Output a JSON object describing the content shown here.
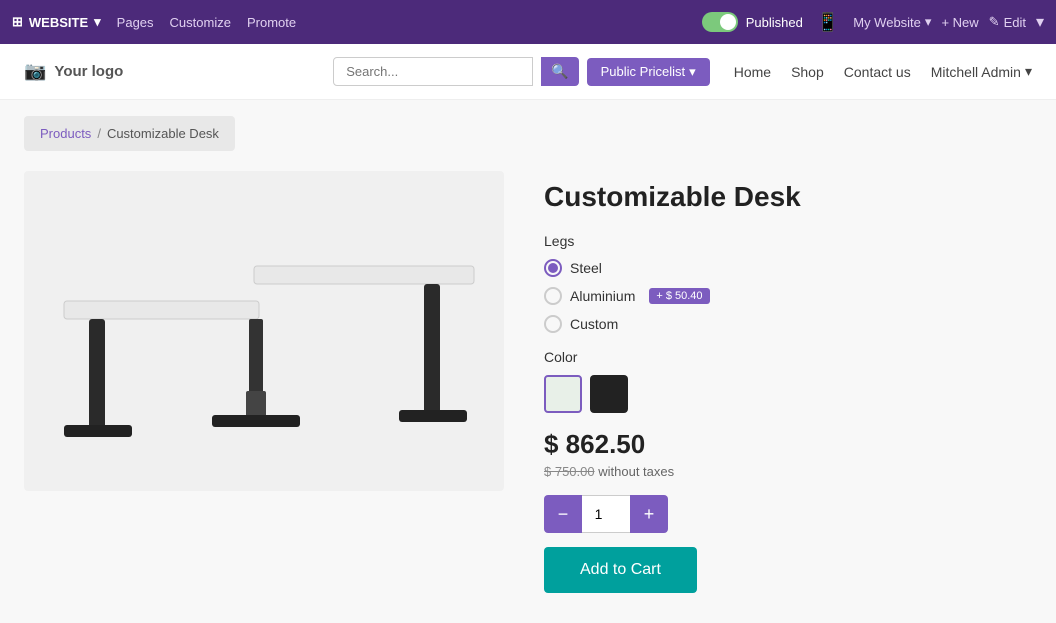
{
  "adminBar": {
    "brand": "WEBSITE",
    "navLinks": [
      "Pages",
      "Customize",
      "Promote"
    ],
    "toggleLabel": "Published",
    "mobileIconLabel": "mobile-icon",
    "myWebsite": "My Website",
    "new": "+ New",
    "edit": "Edit",
    "more": "▼"
  },
  "siteHeader": {
    "logoIcon": "📷",
    "logoText": "Your logo",
    "navLinks": [
      "Home",
      "Shop",
      "Contact us"
    ],
    "adminUser": "Mitchell Admin"
  },
  "breadcrumb": {
    "products": "Products",
    "separator": "/",
    "current": "Customizable Desk"
  },
  "product": {
    "title": "Customizable Desk",
    "options": {
      "legs": {
        "label": "Legs",
        "choices": [
          {
            "id": "steel",
            "text": "Steel",
            "selected": true,
            "badge": null
          },
          {
            "id": "aluminium",
            "text": "Aluminium",
            "selected": false,
            "badge": "+ $ 50.40"
          },
          {
            "id": "custom",
            "text": "Custom",
            "selected": false,
            "badge": null
          }
        ]
      },
      "color": {
        "label": "Color",
        "swatches": [
          {
            "id": "white",
            "hex": "#e8f0e8",
            "selected": true
          },
          {
            "id": "black",
            "hex": "#222222",
            "selected": false
          }
        ]
      }
    },
    "priceMain": "$ 862.50",
    "priceSub": "$ 750.00 without taxes",
    "priceSubCrossed": "$ 750.00",
    "priceSubSuffix": " without taxes",
    "quantity": "1",
    "addToCart": "Add to Cart"
  },
  "search": {
    "placeholder": "Search...",
    "pricelist": "Public Pricelist"
  }
}
